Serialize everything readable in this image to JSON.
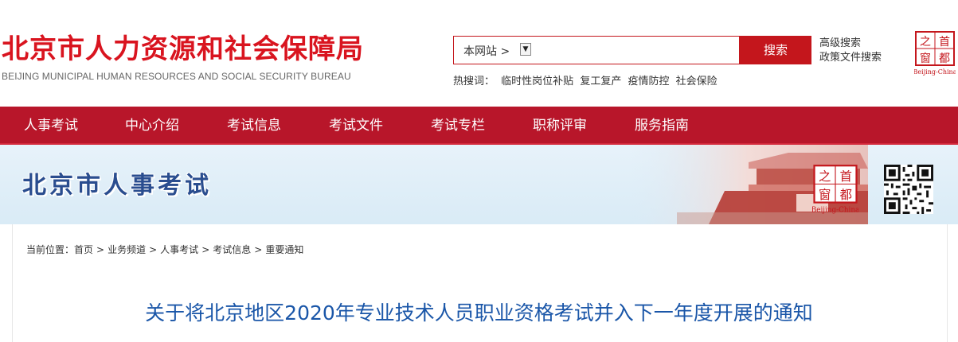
{
  "header": {
    "title": "北京市人力资源和社会保障局",
    "subtitle": "BEIJING MUNICIPAL HUMAN RESOURCES AND SOCIAL SECURITY BUREAU",
    "search": {
      "scope": "本网站 >",
      "button": "搜索",
      "advanced": "高级搜索",
      "policy": "政策文件搜索"
    },
    "hot": {
      "label": "热搜词：",
      "terms": [
        "临时性岗位补贴",
        "复工复产",
        "疫情防控",
        "社会保险"
      ]
    },
    "logo": {
      "char_zhi": "之",
      "char_shou": "首",
      "char_chuang": "窗",
      "char_du": "都",
      "caption": "Beijing-China"
    }
  },
  "nav": {
    "items": [
      "人事考试",
      "中心介绍",
      "考试信息",
      "考试文件",
      "考试专栏",
      "职称评审",
      "服务指南"
    ]
  },
  "banner": {
    "title": "北京市人事考试",
    "logo": {
      "char_zhi": "之",
      "char_shou": "首",
      "char_chuang": "窗",
      "char_du": "都",
      "caption": "Beijing-China"
    }
  },
  "breadcrumb": {
    "label": "当前位置：",
    "items": [
      "首页",
      "业务频道",
      "人事考试",
      "考试信息",
      "重要通知"
    ]
  },
  "article": {
    "title": "关于将北京地区2020年专业技术人员职业资格考试并入下一年度开展的通知"
  },
  "colors": {
    "brand_red": "#c4161c",
    "nav_red": "#b8162a",
    "title_blue": "#1a56a8",
    "banner_blue": "#2a4d8f"
  }
}
